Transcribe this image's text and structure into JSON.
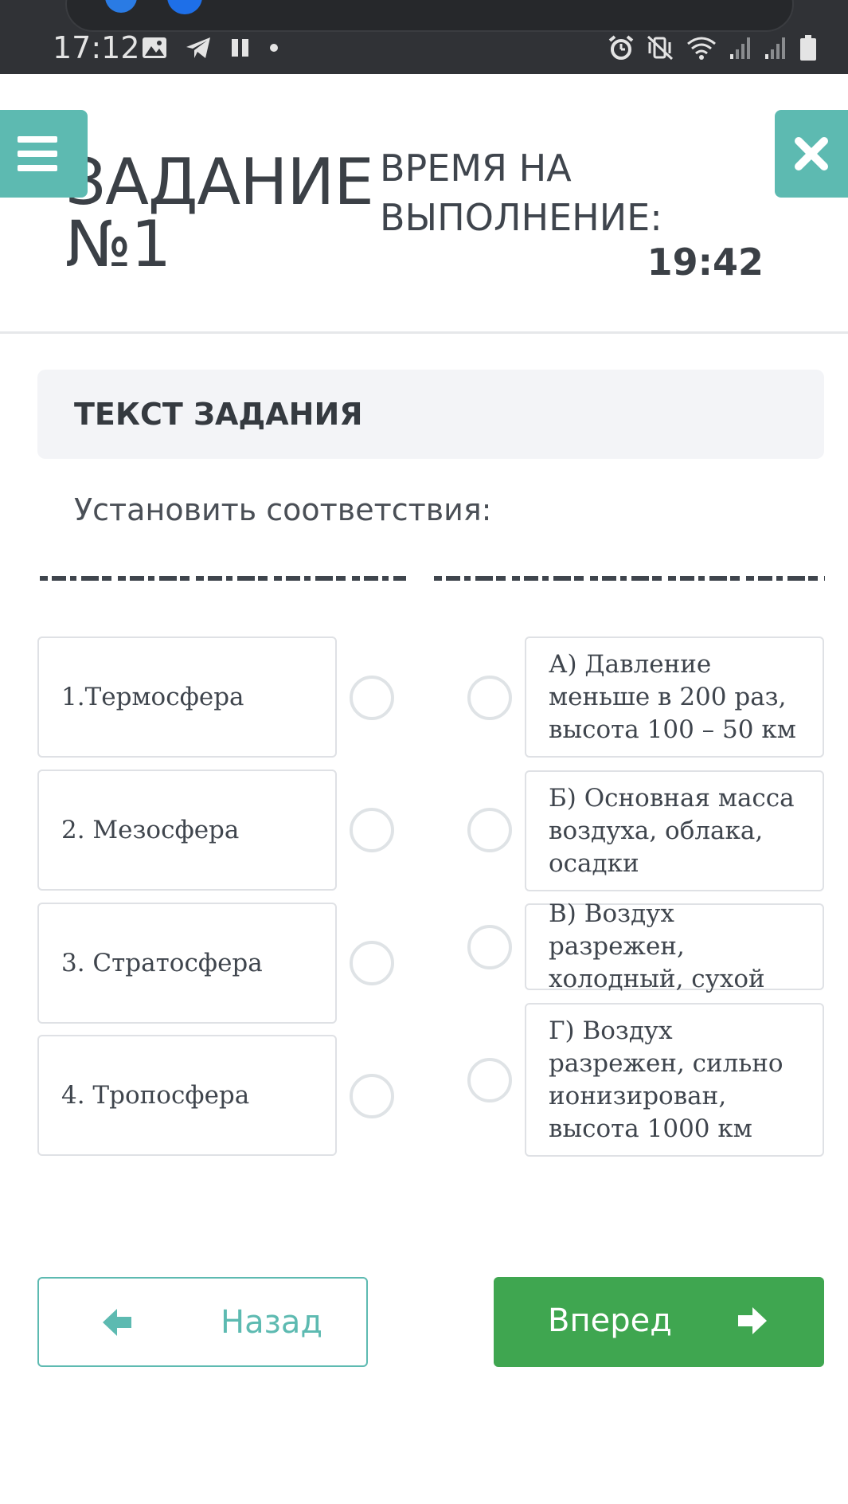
{
  "status_bar": {
    "time": "17:12"
  },
  "header": {
    "title": "ЗАДАНИЕ №1",
    "time_label": "ВРЕМЯ НА ВЫПОЛНЕНИЕ:",
    "time_value": "19:42"
  },
  "task": {
    "section_title": "ТЕКСТ ЗАДАНИЯ",
    "instruction": "Установить соответствия:"
  },
  "matching": {
    "left_items": [
      "1.Термосфера",
      "2. Мезосфера",
      "3. Стратосфера",
      "4. Тропосфера"
    ],
    "right_items": [
      "А) Давление меньше в 200 раз, высота 100 – 50 км",
      "Б) Основная масса воздуха, облака, осадки",
      "В) Воздух разрежен, холодный, сухой",
      "Г) Воздух разрежен, сильно ионизирован, высота 1000 км"
    ]
  },
  "navigation": {
    "back_label": "Назад",
    "next_label": "Вперед"
  },
  "colors": {
    "accent_teal": "#5dbab1",
    "next_green": "#3fa650",
    "status_bar": "#303236"
  },
  "icons": {
    "menu": "hamburger-icon",
    "close": "close-icon",
    "back": "arrow-left-icon",
    "next": "arrow-right-icon"
  }
}
